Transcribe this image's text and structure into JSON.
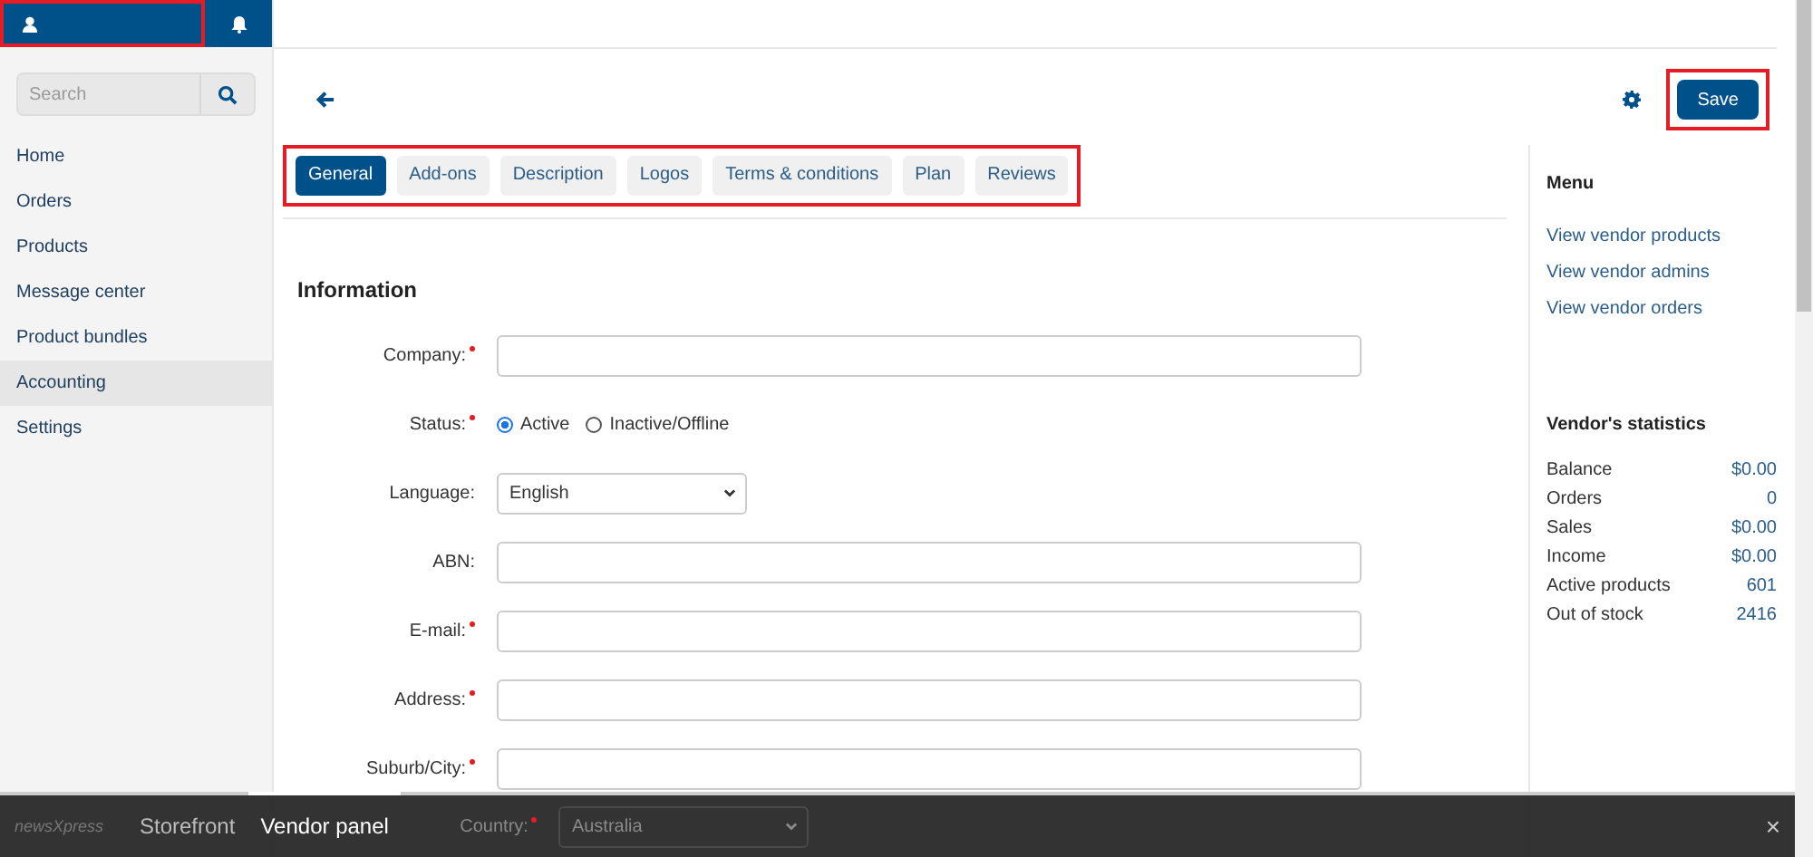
{
  "header": {
    "user_button": {
      "highlighted": true
    }
  },
  "sidebar": {
    "search": {
      "placeholder": "Search"
    },
    "items": [
      {
        "label": "Home",
        "selected": false
      },
      {
        "label": "Orders",
        "selected": false
      },
      {
        "label": "Products",
        "selected": false
      },
      {
        "label": "Message center",
        "selected": false
      },
      {
        "label": "Product bundles",
        "selected": false
      },
      {
        "label": "Accounting",
        "selected": true
      },
      {
        "label": "Settings",
        "selected": false
      }
    ]
  },
  "toolbar": {
    "save_button": {
      "label": "Save",
      "highlighted": true
    }
  },
  "tabs": {
    "highlighted": true,
    "items": [
      {
        "label": "General",
        "selected": true
      },
      {
        "label": "Add-ons",
        "selected": false
      },
      {
        "label": "Description",
        "selected": false
      },
      {
        "label": "Logos",
        "selected": false
      },
      {
        "label": "Terms & conditions",
        "selected": false
      },
      {
        "label": "Plan",
        "selected": false
      },
      {
        "label": "Reviews",
        "selected": false
      }
    ]
  },
  "form": {
    "title": "Information",
    "fields": [
      {
        "kind": "text",
        "label": "Company:",
        "required": true
      },
      {
        "kind": "radio",
        "label": "Status:",
        "required": true,
        "options": [
          {
            "label": "Active",
            "selected": true
          },
          {
            "label": "Inactive/Offline",
            "selected": false
          }
        ]
      },
      {
        "kind": "select",
        "label": "Language:",
        "required": false,
        "value": "English"
      },
      {
        "kind": "text",
        "label": "ABN:",
        "required": false
      },
      {
        "kind": "text",
        "label": "E-mail:",
        "required": true
      },
      {
        "kind": "text",
        "label": "Address:",
        "required": true
      },
      {
        "kind": "text",
        "label": "Suburb/City:",
        "required": true
      },
      {
        "kind": "select",
        "label": "Country:",
        "required": true,
        "value": "Australia"
      }
    ]
  },
  "side_panel": {
    "menu_title": "Menu",
    "links": [
      "View vendor products",
      "View vendor admins",
      "View vendor orders"
    ],
    "stats_title": "Vendor's statistics",
    "stats": [
      {
        "label": "Balance",
        "value": "$0.00"
      },
      {
        "label": "Orders",
        "value": "0"
      },
      {
        "label": "Sales",
        "value": "$0.00"
      },
      {
        "label": "Income",
        "value": "$0.00"
      },
      {
        "label": "Active products",
        "value": "601"
      },
      {
        "label": "Out of stock",
        "value": "2416"
      }
    ]
  },
  "bottom_bar": {
    "logo": "newsXpress",
    "tabs": [
      {
        "label": "Storefront",
        "selected": false
      },
      {
        "label": "Vendor panel",
        "selected": true
      }
    ],
    "close": "×"
  }
}
